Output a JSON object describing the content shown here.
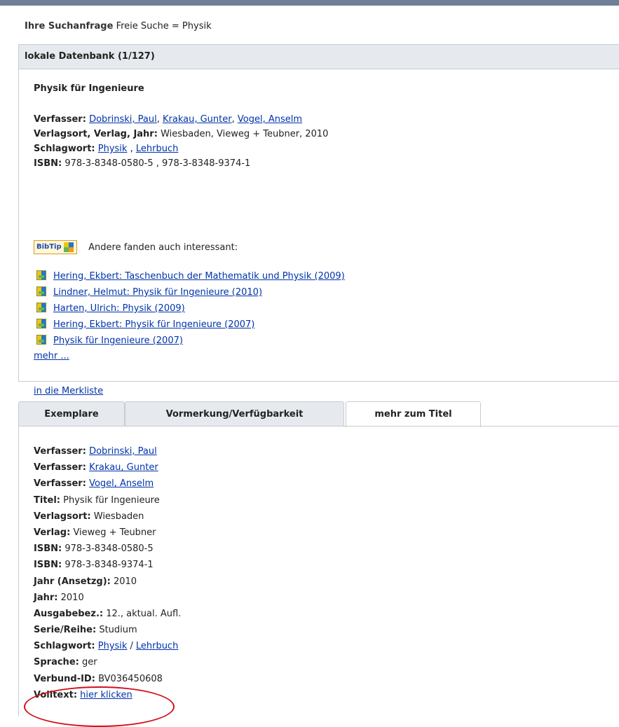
{
  "query": {
    "label": "Ihre Suchanfrage",
    "value": "Freie Suche = Physik"
  },
  "database": {
    "header": "lokale Datenbank (1/127)",
    "record": {
      "title": "Physik für Ingenieure",
      "author_label": "Verfasser:",
      "authors": [
        "Dobrinski, Paul",
        "Krakau, Gunter",
        "Vogel, Anselm"
      ],
      "publisher_label": "Verlagsort, Verlag, Jahr:",
      "publisher_value": "Wiesbaden, Vieweg + Teubner, 2010",
      "subject_label": "Schlagwort:",
      "subjects": [
        "Physik",
        "Lehrbuch"
      ],
      "isbn_label": "ISBN:",
      "isbn_value": "978-3-8348-0580-5 , 978-3-8348-9374-1"
    },
    "bibtip": {
      "logo_text": "BibTip",
      "heading": "Andere fanden auch interessant:",
      "items": [
        "Hering, Ekbert: Taschenbuch der Mathematik und Physik (2009)",
        "Lindner, Helmut: Physik für Ingenieure (2010)",
        "Harten, Ulrich: Physik (2009)",
        "Hering, Ekbert: Physik für Ingenieure (2007)",
        "Physik für Ingenieure (2007)"
      ],
      "more": "mehr ..."
    },
    "merkliste": "in die Merkliste"
  },
  "tabs": [
    "Exemplare",
    "Vormerkung/Verfügbarkeit",
    "mehr zum Titel"
  ],
  "active_tab": "mehr zum Titel",
  "details": {
    "verfasser_label": "Verfasser:",
    "verfasser": [
      "Dobrinski, Paul",
      "Krakau, Gunter",
      "Vogel, Anselm"
    ],
    "titel_label": "Titel:",
    "titel": "Physik für Ingenieure",
    "verlagsort_label": "Verlagsort:",
    "verlagsort": "Wiesbaden",
    "verlag_label": "Verlag:",
    "verlag": "Vieweg + Teubner",
    "isbn_label": "ISBN:",
    "isbn1": "978-3-8348-0580-5",
    "isbn2": "978-3-8348-9374-1",
    "jahr_ansetzg_label": "Jahr (Ansetzg):",
    "jahr_ansetzg": "2010",
    "jahr_label": "Jahr:",
    "jahr": "2010",
    "ausgabe_label": "Ausgabebez.:",
    "ausgabe": "12., aktual. Aufl.",
    "serie_label": "Serie/Reihe:",
    "serie": "Studium",
    "schlagwort_label": "Schlagwort:",
    "schlagwort1": "Physik",
    "schlagwort2": "Lehrbuch",
    "sprache_label": "Sprache:",
    "sprache": "ger",
    "verbund_label": "Verbund-ID:",
    "verbund": "BV036450608",
    "volltext_label": "Volltext:",
    "volltext_link": "hier klicken"
  },
  "colors": {
    "link": "#0033aa",
    "header_bg": "#e6e9ed",
    "border": "#c6ccd4",
    "highlight_circle": "#d0101a",
    "topbar": "#6f7f95"
  }
}
